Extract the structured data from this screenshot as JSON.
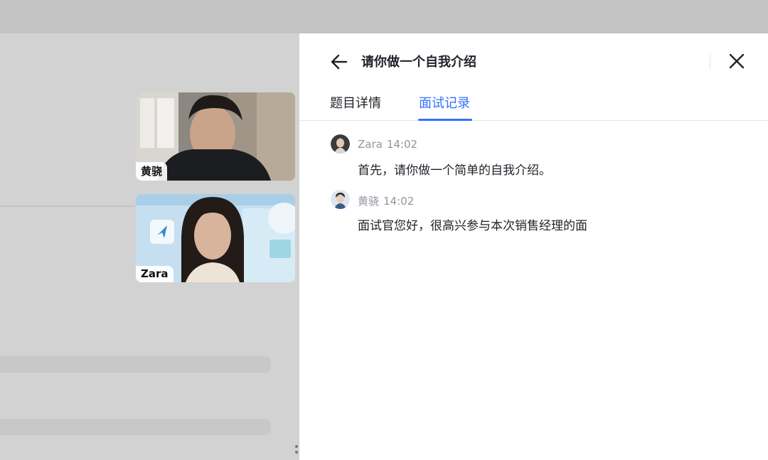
{
  "background": {
    "left_color": "#d2d2d2",
    "top_color": "#c4c4c4"
  },
  "videos": [
    {
      "name": "黄骁"
    },
    {
      "name": "Zara"
    }
  ],
  "panel": {
    "title": "请你做一个自我介绍",
    "back_icon": "arrow-left-icon",
    "close_icon": "close-icon",
    "tabs": [
      {
        "label": "题目详情",
        "active": false
      },
      {
        "label": "面试记录",
        "active": true
      }
    ],
    "accent_color": "#3370ff",
    "messages": [
      {
        "speaker": "Zara",
        "time": "14:02",
        "text": "首先，请你做一个简单的自我介绍。"
      },
      {
        "speaker": "黄骁",
        "time": "14:02",
        "text": "面试官您好，很高兴参与本次销售经理的面"
      }
    ]
  }
}
